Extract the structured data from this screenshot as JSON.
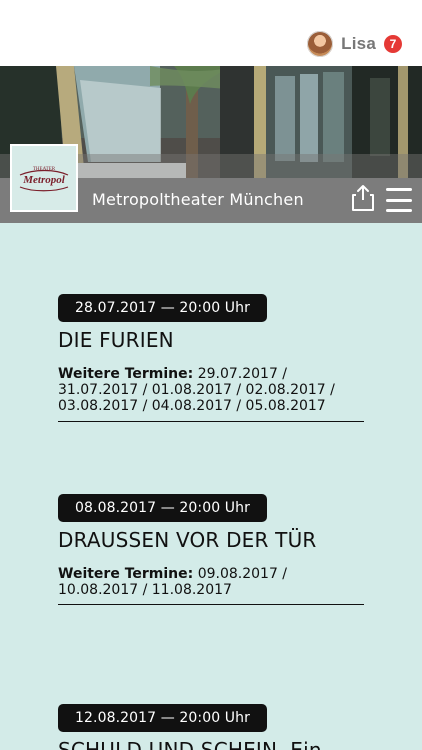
{
  "header": {
    "user_name": "Lisa",
    "notification_count": "7"
  },
  "venue": {
    "logo_text": "Metropol",
    "logo_small_text": "THEATER",
    "name": "Metropoltheater München"
  },
  "events": [
    {
      "datetime": "28.07.2017 — 20:00 Uhr",
      "title": "DIE FURIEN",
      "more_dates_label": "Weitere Termine:",
      "more_dates": "29.07.2017 / 31.07.2017 / 01.08.2017 / 02.08.2017 / 03.08.2017 / 04.08.2017 / 05.08.2017"
    },
    {
      "datetime": "08.08.2017 — 20:00 Uhr",
      "title": "DRAUSSEN VOR DER TÜR",
      "more_dates_label": "Weitere Termine:",
      "more_dates": "09.08.2017 / 10.08.2017 / 11.08.2017"
    },
    {
      "datetime": "12.08.2017 — 20:00 Uhr",
      "title": "SCHULD UND SCHEIN. Ein"
    }
  ],
  "icons": {
    "share": "share-icon",
    "menu": "menu-icon",
    "avatar": "avatar-icon"
  },
  "colors": {
    "background": "#d3ebe8",
    "header_bar": "#7c7c7c",
    "badge": "#e53935",
    "pill": "#111111"
  }
}
